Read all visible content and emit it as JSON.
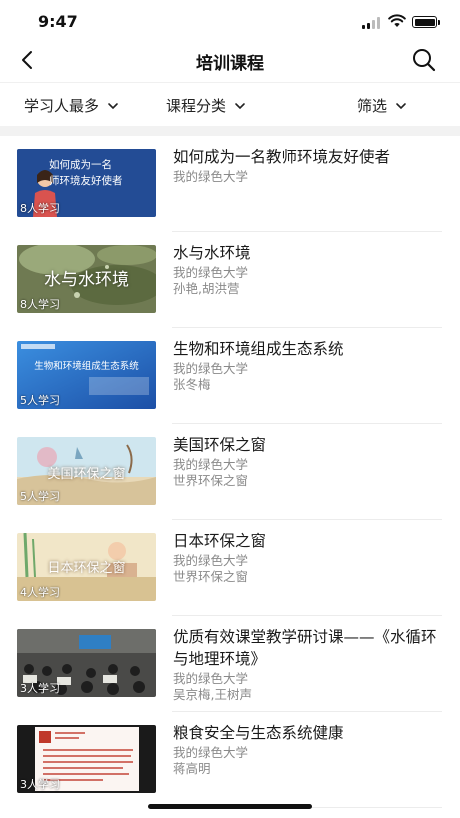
{
  "status": {
    "time": "9:47"
  },
  "nav": {
    "title": "培训课程"
  },
  "filters": {
    "sort": "学习人最多",
    "category": "课程分类",
    "filter": "筛选"
  },
  "courses": [
    {
      "title": "如何成为一名教师环境友好使者",
      "org": "我的绿色大学",
      "teachers": "",
      "count": "8人学习",
      "thumb_text": "如何成为一名\n师环境友好使者"
    },
    {
      "title": "水与水环境",
      "org": "我的绿色大学",
      "teachers": "孙艳,胡洪营",
      "count": "8人学习",
      "thumb_text": "水与水环境"
    },
    {
      "title": "生物和环境组成生态系统",
      "org": "我的绿色大学",
      "teachers": "张冬梅",
      "count": "5人学习",
      "thumb_text": "生物和环境组成生态系统"
    },
    {
      "title": "美国环保之窗",
      "org": "我的绿色大学",
      "teachers": "世界环保之窗",
      "count": "5人学习",
      "thumb_text": "美国环保之窗"
    },
    {
      "title": "日本环保之窗",
      "org": "我的绿色大学",
      "teachers": "世界环保之窗",
      "count": "4人学习",
      "thumb_text": "日本环保之窗"
    },
    {
      "title": "优质有效课堂教学研讨课——《水循环与地理环境》",
      "org": "我的绿色大学",
      "teachers": "吴京梅,王树声",
      "count": "3人学习",
      "thumb_text": ""
    },
    {
      "title": "粮食安全与生态系统健康",
      "org": "我的绿色大学",
      "teachers": "蒋高明",
      "count": "3人学习",
      "thumb_text": ""
    }
  ]
}
